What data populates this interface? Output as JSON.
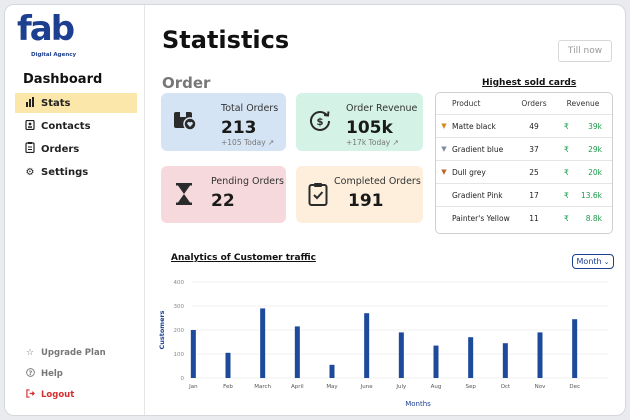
{
  "brand": {
    "logo_text": "fab",
    "tagline": "Digital Agency",
    "color": "#1d3f8f"
  },
  "sidebar": {
    "title": "Dashboard",
    "items": [
      {
        "label": "Stats",
        "icon": "bar-chart-icon",
        "active": true
      },
      {
        "label": "Contacts",
        "icon": "contacts-icon",
        "active": false
      },
      {
        "label": "Orders",
        "icon": "clipboard-icon",
        "active": false
      },
      {
        "label": "Settings",
        "icon": "gear-icon",
        "active": false
      }
    ],
    "bottom": [
      {
        "label": "Upgrade Plan",
        "icon": "star-icon"
      },
      {
        "label": "Help",
        "icon": "help-icon"
      },
      {
        "label": "Logout",
        "icon": "logout-icon"
      }
    ]
  },
  "header": {
    "title": "Statistics",
    "till_now": "Till now"
  },
  "order": {
    "heading": "Order",
    "cards": [
      {
        "label": "Total Orders",
        "value": "213",
        "sub": "+105 Today ↗",
        "color": "#d5e4f4"
      },
      {
        "label": "Order Revenue",
        "value": "105k",
        "sub": "+17k Today ↗",
        "color": "#d4f2e6"
      },
      {
        "label": "Pending Orders",
        "value": "22",
        "color": "#f6d9dc"
      },
      {
        "label": "Completed Orders",
        "value": "191",
        "color": "#fdefdc"
      }
    ]
  },
  "top_products": {
    "title": "Highest sold cards",
    "headers": {
      "product": "Product",
      "orders": "Orders",
      "revenue": "Revenue"
    },
    "currency": "₹",
    "rows": [
      {
        "product": "Matte black",
        "orders": "49",
        "revenue": "39k",
        "medal": "gold"
      },
      {
        "product": "Gradient blue",
        "orders": "37",
        "revenue": "29k",
        "medal": "silver"
      },
      {
        "product": "Dull grey",
        "orders": "25",
        "revenue": "20k",
        "medal": "bronze"
      },
      {
        "product": "Gradient Pink",
        "orders": "17",
        "revenue": "13.6k",
        "medal": "none"
      },
      {
        "product": "Painter's Yellow",
        "orders": "11",
        "revenue": "8.8k",
        "medal": "none"
      }
    ]
  },
  "analytics": {
    "title": "Analytics of Customer traffic",
    "period": "Month"
  },
  "chart_data": {
    "type": "bar",
    "categories": [
      "Jan",
      "Feb",
      "March",
      "April",
      "May",
      "June",
      "July",
      "Aug",
      "Sep",
      "Oct",
      "Nov",
      "Dec"
    ],
    "values": [
      200,
      105,
      290,
      215,
      55,
      270,
      190,
      135,
      170,
      145,
      190,
      245
    ],
    "xlabel": "Months",
    "ylabel": "Customers",
    "ylim": [
      0,
      400
    ],
    "yticks": [
      0,
      100,
      200,
      300,
      400
    ],
    "bar_color": "#1d4a9b",
    "grid": true
  }
}
